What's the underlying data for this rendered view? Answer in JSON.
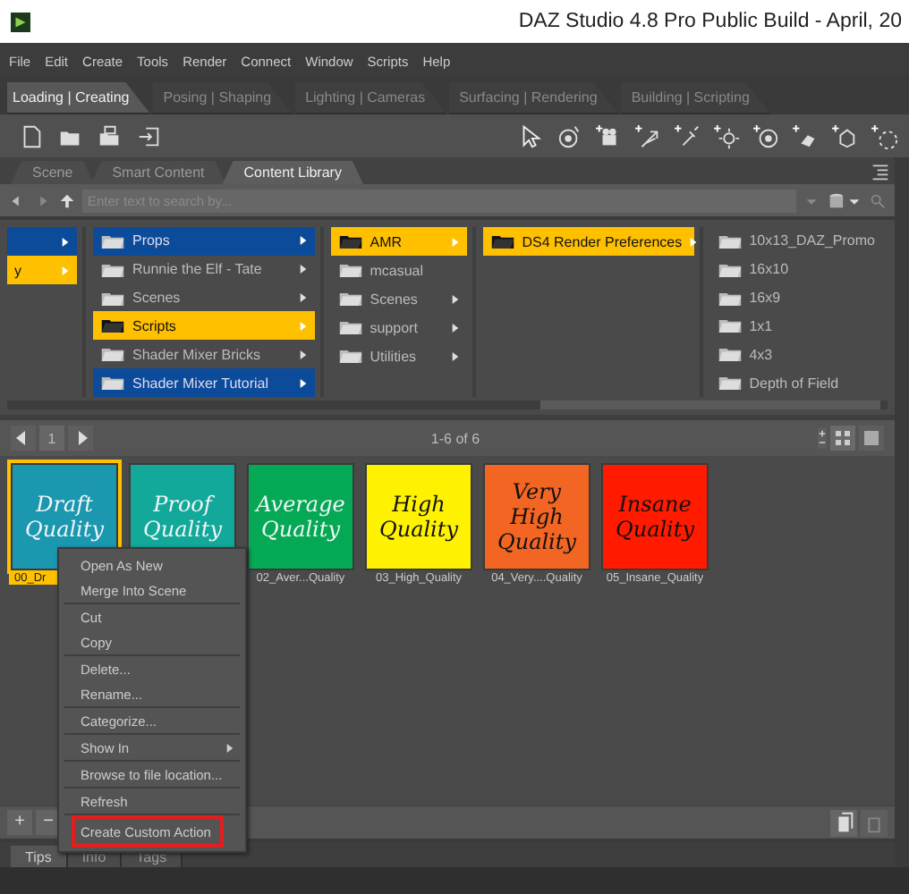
{
  "window": {
    "title": "DAZ Studio 4.8 Pro Public Build - April, 20"
  },
  "menu": [
    "File",
    "Edit",
    "Create",
    "Tools",
    "Render",
    "Connect",
    "Window",
    "Scripts",
    "Help"
  ],
  "workspace_tabs": [
    {
      "label": "Loading | Creating",
      "selected": true
    },
    {
      "label": "Posing | Shaping",
      "selected": false
    },
    {
      "label": "Lighting | Cameras",
      "selected": false
    },
    {
      "label": "Surfacing | Rendering",
      "selected": false
    },
    {
      "label": "Building | Scripting",
      "selected": false
    }
  ],
  "pane_tabs": [
    {
      "label": "Scene",
      "selected": false
    },
    {
      "label": "Smart Content",
      "selected": false
    },
    {
      "label": "Content Library",
      "selected": true
    }
  ],
  "search": {
    "placeholder": "Enter text to search by..."
  },
  "columns": [
    [
      {
        "selected": true,
        "open": false,
        "has_children": true
      },
      {
        "label": "y",
        "selected": false,
        "open": true,
        "has_children": true
      }
    ],
    [
      {
        "label": "Props",
        "selected": true,
        "open": false,
        "has_children": true
      },
      {
        "label": "Runnie the Elf - Tate",
        "selected": false,
        "open": false,
        "has_children": true
      },
      {
        "label": "Scenes",
        "selected": false,
        "open": false,
        "has_children": true
      },
      {
        "label": "Scripts",
        "selected": false,
        "open": true,
        "has_children": true
      },
      {
        "label": "Shader Mixer Bricks",
        "selected": false,
        "open": false,
        "has_children": true
      },
      {
        "label": "Shader Mixer Tutorial",
        "selected": true,
        "open": false,
        "has_children": true
      }
    ],
    [
      {
        "label": "AMR",
        "selected": false,
        "open": true,
        "has_children": true
      },
      {
        "label": "mcasual",
        "selected": false,
        "open": false,
        "has_children": false
      },
      {
        "label": "Scenes",
        "selected": false,
        "open": false,
        "has_children": true
      },
      {
        "label": "support",
        "selected": false,
        "open": false,
        "has_children": true
      },
      {
        "label": "Utilities",
        "selected": false,
        "open": false,
        "has_children": true
      }
    ],
    [
      {
        "label": "DS4 Render Preferences",
        "selected": false,
        "open": true,
        "has_children": true
      }
    ],
    [
      {
        "label": "10x13_DAZ_Promo",
        "selected": false,
        "open": false,
        "has_children": false
      },
      {
        "label": "16x10",
        "selected": false,
        "open": false,
        "has_children": false
      },
      {
        "label": "16x9",
        "selected": false,
        "open": false,
        "has_children": false
      },
      {
        "label": "1x1",
        "selected": false,
        "open": false,
        "has_children": false
      },
      {
        "label": "4x3",
        "selected": false,
        "open": false,
        "has_children": false
      },
      {
        "label": "Depth of Field",
        "selected": false,
        "open": false,
        "has_children": false
      }
    ]
  ],
  "pager": {
    "page": "1",
    "count": "1-6 of 6"
  },
  "thumbnails": [
    {
      "lines": [
        "Draft",
        "Quality"
      ],
      "label": "00_Dr",
      "color": "#1b97b0",
      "dark_text": false,
      "selected": true
    },
    {
      "lines": [
        "Proof",
        "Quality"
      ],
      "color": "#12a89a",
      "dark_text": false,
      "selected": false
    },
    {
      "lines": [
        "Average",
        "Quality"
      ],
      "label": "02_Aver...Quality",
      "color": "#05a854",
      "dark_text": false,
      "selected": false
    },
    {
      "lines": [
        "High",
        "Quality"
      ],
      "label": "03_High_Quality",
      "color": "#fff200",
      "dark_text": true,
      "selected": false
    },
    {
      "lines": [
        "Very",
        "High",
        "Quality"
      ],
      "label": "04_Very....Quality",
      "color": "#f26522",
      "dark_text": true,
      "selected": false
    },
    {
      "lines": [
        "Insane",
        "Quality"
      ],
      "label": "05_Insane_Quality",
      "color": "#ff1a00",
      "dark_text": true,
      "selected": false
    }
  ],
  "context_menu": [
    [
      {
        "label": "Open As New",
        "submenu": false,
        "outlined": false
      },
      {
        "label": "Merge Into Scene",
        "submenu": false,
        "outlined": false
      }
    ],
    [
      {
        "label": "Cut",
        "submenu": false,
        "outlined": false
      },
      {
        "label": "Copy",
        "submenu": false,
        "outlined": false
      }
    ],
    [
      {
        "label": "Delete...",
        "submenu": false,
        "outlined": false
      },
      {
        "label": "Rename...",
        "submenu": false,
        "outlined": false
      }
    ],
    [
      {
        "label": "Categorize...",
        "submenu": false,
        "outlined": false
      }
    ],
    [
      {
        "label": "Show In",
        "submenu": true,
        "outlined": false
      }
    ],
    [
      {
        "label": "Browse to file location...",
        "submenu": false,
        "outlined": false
      }
    ],
    [
      {
        "label": "Refresh",
        "submenu": false,
        "outlined": false
      }
    ],
    [
      {
        "label": "Create Custom Action",
        "submenu": false,
        "outlined": true
      }
    ]
  ],
  "bottom_buttons": [
    "+",
    "−"
  ],
  "info_tabs": [
    {
      "label": "Tips",
      "selected": true
    },
    {
      "label": "Info",
      "selected": false
    },
    {
      "label": "Tags",
      "selected": false
    }
  ]
}
